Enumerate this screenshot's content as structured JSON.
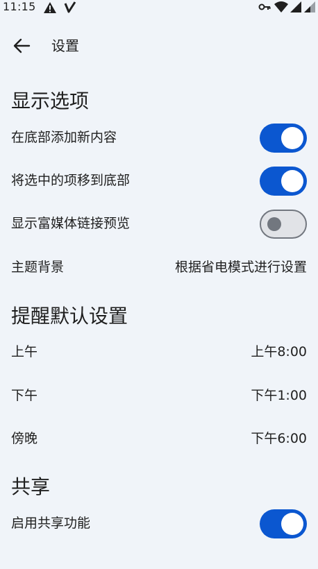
{
  "status_bar": {
    "time": "11:15",
    "icons": [
      "warning-icon",
      "check-signature-icon",
      "vpn-key-icon",
      "wifi-icon",
      "cell-signal-icon",
      "battery-icon"
    ]
  },
  "header": {
    "title": "设置"
  },
  "sections": {
    "display": {
      "title": "显示选项",
      "add_bottom": {
        "label": "在底部添加新内容",
        "checked": true
      },
      "move_checked": {
        "label": "将选中的项移到底部",
        "checked": true
      },
      "rich_preview": {
        "label": "显示富媒体链接预览",
        "checked": false
      },
      "theme": {
        "label": "主题背景",
        "value": "根据省电模式进行设置"
      }
    },
    "reminder": {
      "title": "提醒默认设置",
      "morning": {
        "label": "上午",
        "value": "上午8:00"
      },
      "afternoon": {
        "label": "下午",
        "value": "下午1:00"
      },
      "evening": {
        "label": "傍晚",
        "value": "下午6:00"
      }
    },
    "sharing": {
      "title": "共享",
      "enable_sharing": {
        "label": "启用共享功能",
        "checked": true
      }
    }
  },
  "colors": {
    "background": "#f0f4f9",
    "accent": "#0b57d0",
    "switch_off_track": "#e1e3e7",
    "switch_off_outline": "#72777f"
  }
}
